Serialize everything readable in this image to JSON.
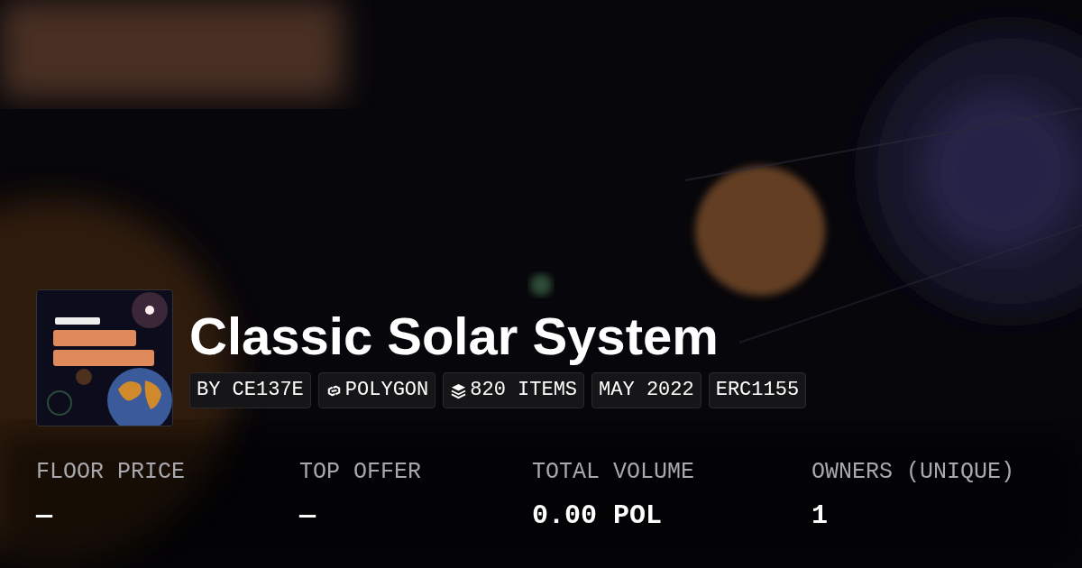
{
  "collection": {
    "title": "Classic Solar System",
    "tags": [
      {
        "label": "BY CE137E",
        "kind": "creator"
      },
      {
        "label": "POLYGON",
        "kind": "chain"
      },
      {
        "label": "820 ITEMS",
        "kind": "items"
      },
      {
        "label": "MAY 2022",
        "kind": "date"
      },
      {
        "label": "ERC1155",
        "kind": "standard"
      }
    ]
  },
  "stats": [
    {
      "label": "FLOOR PRICE",
      "value": "—"
    },
    {
      "label": "TOP OFFER",
      "value": "—"
    },
    {
      "label": "TOTAL VOLUME",
      "value": "0.00 POL"
    },
    {
      "label": "OWNERS (UNIQUE)",
      "value": "1"
    }
  ]
}
